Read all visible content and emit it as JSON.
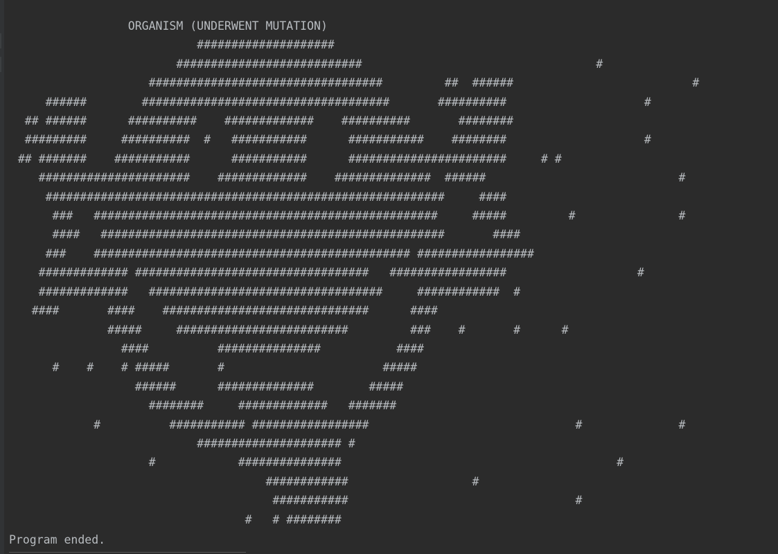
{
  "console": {
    "lines": [
      "                  ORGANISM (UNDERWENT MUTATION)",
      "                            ####################",
      "                         ###########################                                  #",
      "                     ##################################         ##  ######                          #",
      "      ######        ####################################       ##########                    #",
      "   ## ######      ##########    #############    ##########       ########",
      "   #########     ##########  #   ###########      ###########    ########                    #",
      "  ## #######    ###########      ###########      #######################     # #",
      "     ######################    #############    ##############  ######                            #",
      "      ##########################################################     ####",
      "       ###   ##################################################     #####         #               #",
      "       ####   ##################################################       ####",
      "      ###    ############################################## #################",
      "     ############# ##################################   #################                   #",
      "     #############   ##################################     ############  #",
      "    ####       ####    ##############################      ####",
      "               #####     #########################         ###    #       #      #",
      "                 ####          ###############           ####",
      "       #    #    # #####       #                       #####",
      "                   ######      ##############        #####",
      "                     ########     #############   #######",
      "             #          ########### #################                              #              #",
      "                            ##################### #",
      "                     #            ###############                                        #",
      "                                      ############                  #",
      "                                       ###########                                 #",
      "                                   #   # ########"
    ],
    "status": "Program ended."
  }
}
